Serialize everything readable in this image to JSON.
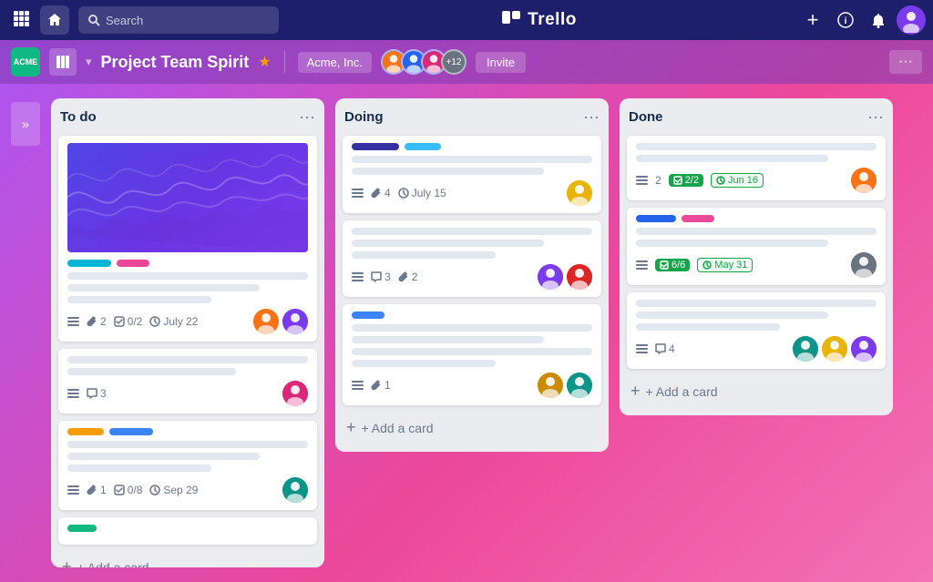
{
  "app": {
    "name": "Trello",
    "logo_text": "T"
  },
  "top_nav": {
    "grid_icon": "⊞",
    "home_label": "🏠",
    "search_placeholder": "Search",
    "add_label": "+",
    "info_label": "ℹ",
    "bell_label": "🔔",
    "logo_text": "Trello"
  },
  "board_nav": {
    "acme_label": "ACME",
    "board_icon": "⊞",
    "board_title": "Project Team Spirit",
    "star": "★",
    "team_label": "Acme, Inc.",
    "plus_count": "+12",
    "invite_label": "Invite",
    "more_label": "···"
  },
  "sidebar": {
    "toggle": "»"
  },
  "columns": [
    {
      "id": "todo",
      "title": "To do",
      "cards": [
        {
          "id": "card1",
          "has_image": true,
          "tags": [
            "cyan",
            "pink"
          ],
          "lines": [
            true,
            true,
            true
          ],
          "meta": {
            "list_icon": true,
            "attachments": "2",
            "checklist": "0/2",
            "date": "July 22"
          },
          "avatars": [
            "orange",
            "purple"
          ]
        },
        {
          "id": "card2",
          "lines": [
            true,
            true
          ],
          "meta": {
            "list_icon": true,
            "comments": "3"
          },
          "avatars": [
            "pink"
          ]
        },
        {
          "id": "card3",
          "tags": [
            "yellow",
            "blue"
          ],
          "lines": [
            true,
            true,
            true
          ],
          "meta": {
            "list_icon": true,
            "attachments": "1",
            "checklist": "0/8",
            "date": "Sep 29"
          },
          "avatars": [
            "teal"
          ]
        },
        {
          "id": "card4",
          "tags": [
            "green"
          ],
          "lines": []
        }
      ],
      "add_label": "+ Add a card"
    },
    {
      "id": "doing",
      "title": "Doing",
      "cards": [
        {
          "id": "card5",
          "tags": [
            "dark-blue",
            "light-blue"
          ],
          "lines": [
            true,
            true
          ],
          "meta": {
            "list_icon": true,
            "attachments": "4",
            "date": "July 15"
          },
          "avatars": [
            "yellow2"
          ]
        },
        {
          "id": "card6",
          "lines": [
            true,
            true,
            true
          ],
          "meta": {
            "list_icon": true,
            "comments": "3",
            "attachments": "2"
          },
          "avatars": [
            "purple2",
            "red"
          ]
        },
        {
          "id": "card7",
          "tags": [
            "blue-med"
          ],
          "lines": [
            true,
            true,
            true,
            true
          ],
          "meta": {
            "list_icon": true,
            "attachments": "1"
          },
          "avatars": [
            "yellow3",
            "teal2"
          ]
        }
      ],
      "add_label": "+ Add a card"
    },
    {
      "id": "done",
      "title": "Done",
      "cards": [
        {
          "id": "card8",
          "lines": [
            true,
            true
          ],
          "meta": {
            "list_icon": true,
            "count": "2",
            "checklist_badge": "2/2",
            "date_badge": "Jun 16"
          },
          "avatars": [
            "orange2"
          ]
        },
        {
          "id": "card9",
          "tags": [
            "blue2",
            "pink2"
          ],
          "lines": [
            true,
            true
          ],
          "meta": {
            "list_icon": true,
            "checklist_badge": "6/6",
            "date_badge": "May 31"
          },
          "avatars": [
            "gray"
          ]
        },
        {
          "id": "card10",
          "lines": [
            true,
            true,
            true
          ],
          "meta": {
            "list_icon": true,
            "comments": "4"
          },
          "avatars": [
            "teal3",
            "yellow4",
            "purple3"
          ]
        }
      ],
      "add_label": "+ Add a card"
    }
  ]
}
